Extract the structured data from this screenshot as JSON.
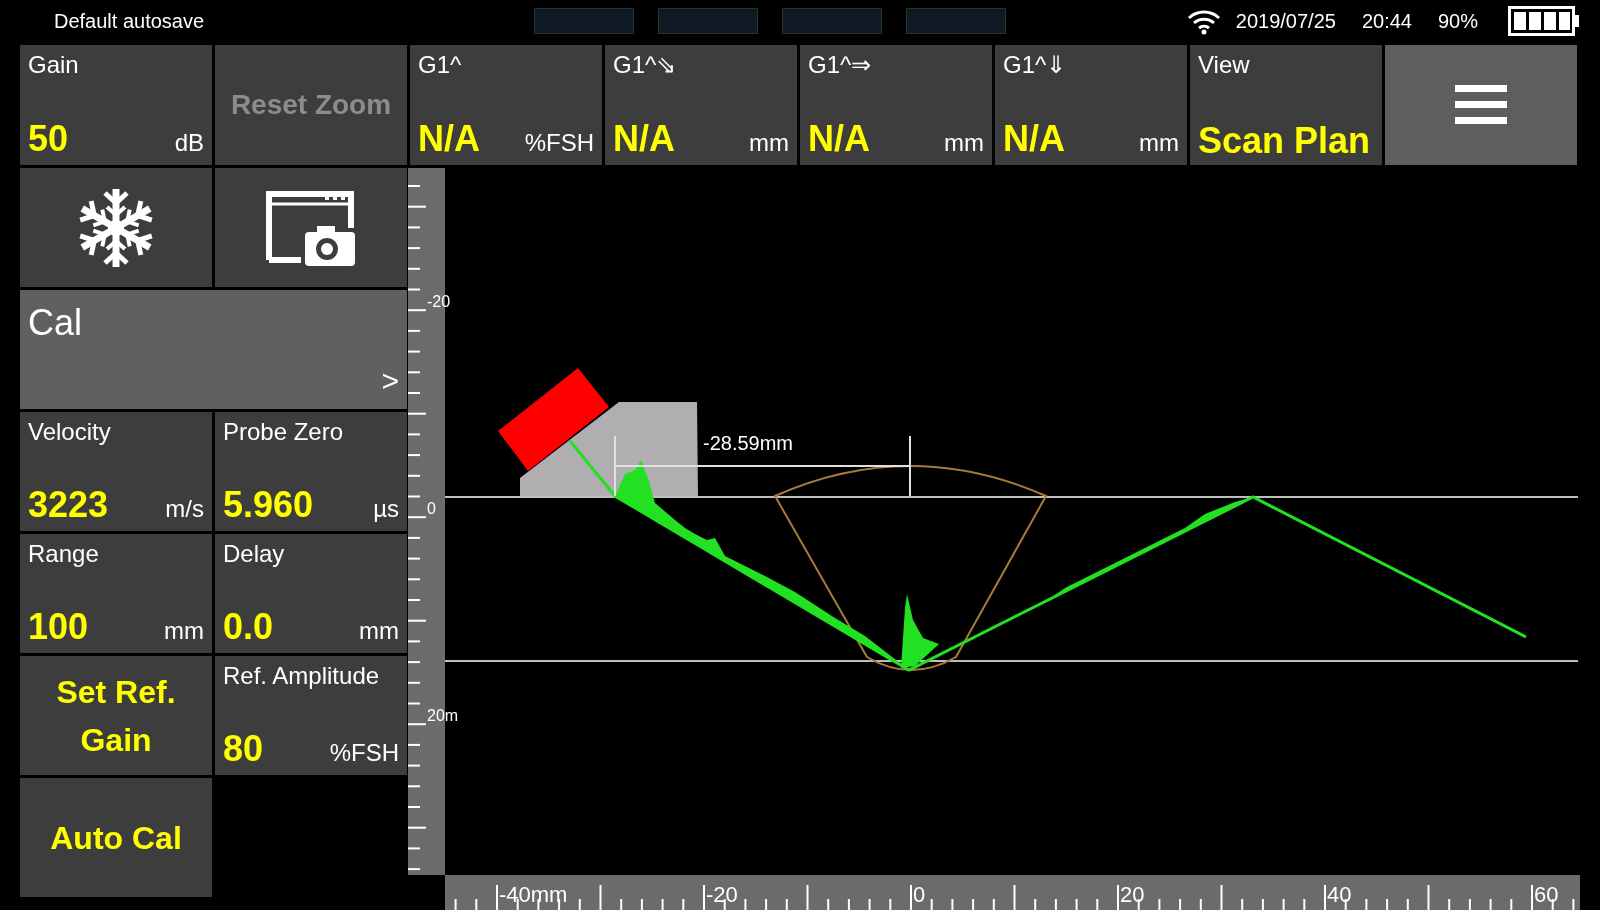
{
  "status_bar": {
    "title": "Default autosave",
    "date": "2019/07/25",
    "time": "20:44",
    "battery_text": "90%"
  },
  "top_tiles": [
    {
      "kind": "param",
      "label": "Gain",
      "value": "50",
      "unit": "dB"
    },
    {
      "kind": "button",
      "label": "Reset Zoom",
      "disabled": true
    },
    {
      "kind": "param",
      "label": "G1^",
      "value": "N/A",
      "unit": "%FSH"
    },
    {
      "kind": "param",
      "label": "G1^⇘",
      "value": "N/A",
      "unit": "mm"
    },
    {
      "kind": "param",
      "label": "G1^⇒",
      "value": "N/A",
      "unit": "mm"
    },
    {
      "kind": "param",
      "label": "G1^⇓",
      "value": "N/A",
      "unit": "mm"
    },
    {
      "kind": "param",
      "label": "View",
      "value": "Scan Plan"
    },
    {
      "kind": "menu"
    }
  ],
  "left_tiles": [
    {
      "kind": "freeze"
    },
    {
      "kind": "screenshot"
    },
    {
      "kind": "section",
      "label": "Cal",
      "arrow": ">"
    },
    {
      "kind": "param",
      "label": "Velocity",
      "value": "3223",
      "unit": "m/s"
    },
    {
      "kind": "param",
      "label": "Probe Zero",
      "value": "5.960",
      "unit": "µs"
    },
    {
      "kind": "param",
      "label": "Range",
      "value": "100",
      "unit": "mm"
    },
    {
      "kind": "param",
      "label": "Delay",
      "value": "0.0",
      "unit": "mm"
    },
    {
      "kind": "button",
      "label": "Set Ref. Gain",
      "disabled": false
    },
    {
      "kind": "param",
      "label": "Ref. Amplitude",
      "value": "80",
      "unit": "%FSH"
    },
    {
      "kind": "button",
      "label": "Auto Cal",
      "disabled": false
    }
  ],
  "scan_plan": {
    "measurement": "-28.59mm",
    "depth_ruler": [
      "-20",
      "0",
      "20m"
    ],
    "distance_ruler": [
      "-40mm",
      "-20",
      "0",
      "20",
      "40",
      "60"
    ]
  }
}
